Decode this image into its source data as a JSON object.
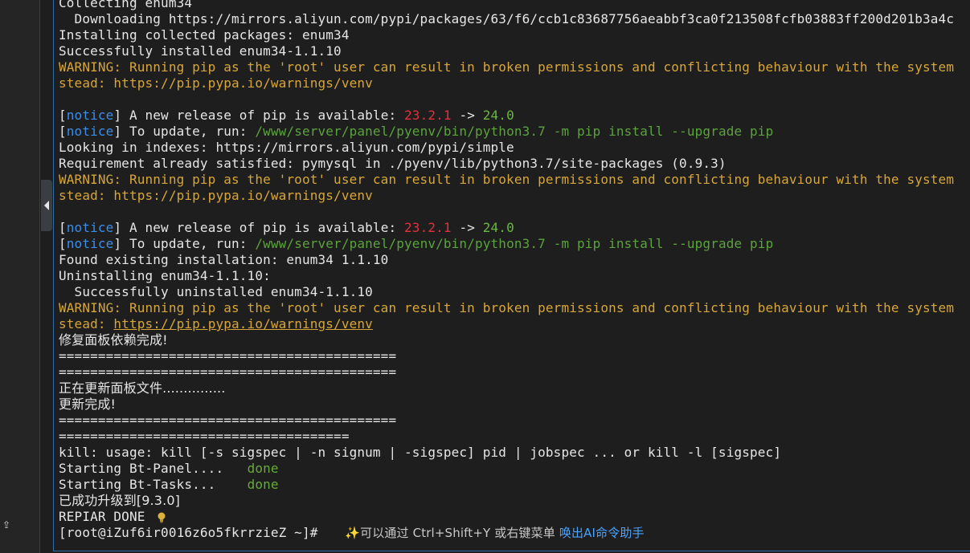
{
  "terminal": {
    "lines": {
      "l1": "Collecting enum34",
      "l2": "  Downloading https://mirrors.aliyun.com/pypi/packages/63/f6/ccb1c83687756aeabbf3ca0f213508fcfb03883ff200d201b3a4c",
      "l3": "Installing collected packages: enum34",
      "l4": "Successfully installed enum34-1.1.10",
      "l5": "WARNING: Running pip as the 'root' user can result in broken permissions and conflicting behaviour with the system",
      "l6": "stead: https://pip.pypa.io/warnings/venv",
      "l8_open": "[",
      "l8_tag": "notice",
      "l8_mid": "] A new release of pip is available: ",
      "l8_old": "23.2.1",
      "l8_arrow": " -> ",
      "l8_new": "24.0",
      "l9_open": "[",
      "l9_tag": "notice",
      "l9_mid": "] To update, run: ",
      "l9_cmd": "/www/server/panel/pyenv/bin/python3.7 -m pip install --upgrade pip",
      "l10": "Looking in indexes: https://mirrors.aliyun.com/pypi/simple",
      "l11": "Requirement already satisfied: pymysql in ./pyenv/lib/python3.7/site-packages (0.9.3)",
      "l12": "WARNING: Running pip as the 'root' user can result in broken permissions and conflicting behaviour with the system",
      "l13": "stead: https://pip.pypa.io/warnings/venv",
      "l15_open": "[",
      "l15_tag": "notice",
      "l15_mid": "] A new release of pip is available: ",
      "l15_old": "23.2.1",
      "l15_arrow": " -> ",
      "l15_new": "24.0",
      "l16_open": "[",
      "l16_tag": "notice",
      "l16_mid": "] To update, run: ",
      "l16_cmd": "/www/server/panel/pyenv/bin/python3.7 -m pip install --upgrade pip",
      "l17": "Found existing installation: enum34 1.1.10",
      "l18": "Uninstalling enum34-1.1.10:",
      "l19": "  Successfully uninstalled enum34-1.1.10",
      "l20": "WARNING: Running pip as the 'root' user can result in broken permissions and conflicting behaviour with the system",
      "l21_pre": "stead: ",
      "l21_link": "https://pip.pypa.io/warnings/venv",
      "l22": "修复面板依赖完成!",
      "l23": "===========================================",
      "l24": "===========================================",
      "l25": "正在更新面板文件...............",
      "l26": "更新完成!",
      "l27": "===========================================",
      "l28": "=====================================",
      "l29": "kill: usage: kill [-s sigspec | -n signum | -sigspec] pid | jobspec ... or kill -l [sigspec]",
      "l30_a": "Starting Bt-Panel....   ",
      "l30_b": "done",
      "l31_a": "Starting Bt-Tasks...    ",
      "l31_b": "done",
      "l32": "已成功升级到[9.3.0]",
      "l33": "REPIAR DONE",
      "prompt": "[root@iZuf6ir0016z6o5fkrrzieZ ~]# "
    },
    "hint": {
      "sparkle": "✨",
      "text": "可以通过 Ctrl+Shift+Y 或右键菜单 ",
      "link": "唤出AI命令助手"
    },
    "colors": {
      "warning": "#d7a63a",
      "notice": "#3b8eea",
      "old_version": "#e0323c",
      "new_version": "#6ab83f",
      "done": "#66aa3a",
      "link": "#4aa3ff"
    }
  }
}
